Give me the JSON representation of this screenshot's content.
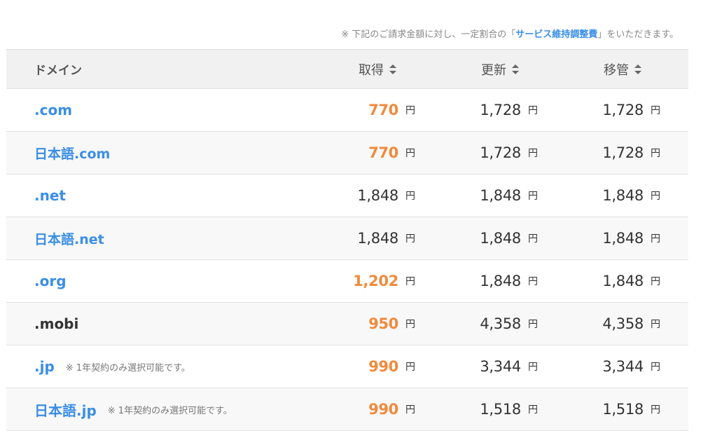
{
  "notice": {
    "prefix": "※ 下記のご請求金額に対し、一定割合の「",
    "link": "サービス維持調整費",
    "suffix": "」をいただきます。"
  },
  "table": {
    "headers": {
      "domain": "ドメイン",
      "get": "取得",
      "renew": "更新",
      "transfer": "移管"
    },
    "currency": "円",
    "rows": [
      {
        "domain": ".com",
        "note": "",
        "get": "770",
        "renew": "1,728",
        "transfer": "1,728",
        "get_sale": true,
        "link": true
      },
      {
        "domain": "日本語.com",
        "note": "",
        "get": "770",
        "renew": "1,728",
        "transfer": "1,728",
        "get_sale": true,
        "link": true
      },
      {
        "domain": ".net",
        "note": "",
        "get": "1,848",
        "renew": "1,848",
        "transfer": "1,848",
        "get_sale": false,
        "link": true
      },
      {
        "domain": "日本語.net",
        "note": "",
        "get": "1,848",
        "renew": "1,848",
        "transfer": "1,848",
        "get_sale": false,
        "link": true
      },
      {
        "domain": ".org",
        "note": "",
        "get": "1,202",
        "renew": "1,848",
        "transfer": "1,848",
        "get_sale": true,
        "link": true
      },
      {
        "domain": ".mobi",
        "note": "",
        "get": "950",
        "renew": "4,358",
        "transfer": "4,358",
        "get_sale": true,
        "link": false
      },
      {
        "domain": ".jp",
        "note": "※ 1年契約のみ選択可能です。",
        "get": "990",
        "renew": "3,344",
        "transfer": "3,344",
        "get_sale": true,
        "link": true
      },
      {
        "domain": "日本語.jp",
        "note": "※ 1年契約のみ選択可能です。",
        "get": "990",
        "renew": "1,518",
        "transfer": "1,518",
        "get_sale": true,
        "link": true
      }
    ]
  },
  "colors": {
    "link": "#3a8ee6",
    "sale_price": "#f08a3c",
    "header_bg": "#f1f1f1",
    "alt_row_bg": "#f8f8f8"
  },
  "icons": {
    "sort": "sort-icon"
  }
}
